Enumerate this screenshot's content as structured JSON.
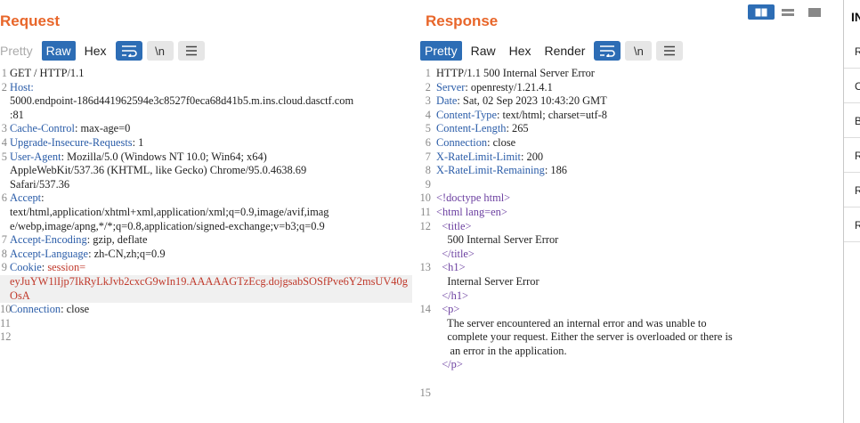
{
  "request": {
    "title": "Request",
    "tabs": [
      "Pretty",
      "Raw",
      "Hex"
    ],
    "active_tab": "Raw",
    "lines": [
      {
        "n": "1",
        "parts": [
          [
            "",
            "GET / HTTP/1.1"
          ]
        ]
      },
      {
        "n": "2",
        "parts": [
          [
            "key",
            "Host:"
          ]
        ]
      },
      {
        "n": "",
        "parts": [
          [
            "",
            "5000.endpoint-186d441962594e3c8527f0eca68d41b5.m.ins.cloud.dasctf.com"
          ]
        ]
      },
      {
        "n": "",
        "parts": [
          [
            "",
            ":81"
          ]
        ]
      },
      {
        "n": "3",
        "parts": [
          [
            "key",
            "Cache-Control"
          ],
          [
            "",
            ": max-age=0"
          ]
        ]
      },
      {
        "n": "4",
        "parts": [
          [
            "key",
            "Upgrade-Insecure-Requests"
          ],
          [
            "",
            ": 1"
          ]
        ]
      },
      {
        "n": "5",
        "parts": [
          [
            "key",
            "User-Agent"
          ],
          [
            "",
            ": Mozilla/5.0 (Windows NT 10.0; Win64; x64)"
          ]
        ]
      },
      {
        "n": "",
        "parts": [
          [
            "",
            "AppleWebKit/537.36 (KHTML, like Gecko) Chrome/95.0.4638.69"
          ]
        ]
      },
      {
        "n": "",
        "parts": [
          [
            "",
            "Safari/537.36"
          ]
        ]
      },
      {
        "n": "6",
        "parts": [
          [
            "key",
            "Accept"
          ],
          [
            "",
            ":"
          ]
        ]
      },
      {
        "n": "",
        "parts": [
          [
            "",
            "text/html,application/xhtml+xml,application/xml;q=0.9,image/avif,imag"
          ]
        ]
      },
      {
        "n": "",
        "parts": [
          [
            "",
            "e/webp,image/apng,*/*;q=0.8,application/signed-exchange;v=b3;q=0.9"
          ]
        ]
      },
      {
        "n": "7",
        "parts": [
          [
            "key",
            "Accept-Encoding"
          ],
          [
            "",
            ": gzip, deflate"
          ]
        ]
      },
      {
        "n": "8",
        "parts": [
          [
            "key",
            "Accept-Language"
          ],
          [
            "",
            ": zh-CN,zh;q=0.9"
          ]
        ]
      },
      {
        "n": "9",
        "parts": [
          [
            "key",
            "Cookie"
          ],
          [
            "",
            ": "
          ],
          [
            "red",
            "session="
          ]
        ]
      },
      {
        "n": "",
        "parts": [
          [
            "red",
            "eyJuYW1lIjp7IkRyLkJvb2cxcG9wIn19.AAAAAGTzEcg.dojgsabSOSfPve6Y2msUV40g"
          ]
        ],
        "hl": true
      },
      {
        "n": "",
        "parts": [
          [
            "red",
            "OsA"
          ]
        ],
        "hl": true
      },
      {
        "n": "10",
        "parts": [
          [
            "key",
            "Connection"
          ],
          [
            "",
            ": close"
          ]
        ]
      },
      {
        "n": "11",
        "parts": [
          [
            "",
            ""
          ]
        ]
      },
      {
        "n": "12",
        "parts": [
          [
            "",
            ""
          ]
        ]
      }
    ]
  },
  "response": {
    "title": "Response",
    "tabs": [
      "Pretty",
      "Raw",
      "Hex",
      "Render"
    ],
    "active_tab": "Pretty",
    "lines": [
      {
        "n": "1",
        "parts": [
          [
            "",
            "HTTP/1.1 500 Internal Server Error"
          ]
        ]
      },
      {
        "n": "2",
        "parts": [
          [
            "key",
            "Server"
          ],
          [
            "",
            ": openresty/1.21.4.1"
          ]
        ]
      },
      {
        "n": "3",
        "parts": [
          [
            "key",
            "Date"
          ],
          [
            "",
            ": Sat, 02 Sep 2023 10:43:20 GMT"
          ]
        ]
      },
      {
        "n": "4",
        "parts": [
          [
            "key",
            "Content-Type"
          ],
          [
            "",
            ": text/html; charset=utf-8"
          ]
        ]
      },
      {
        "n": "5",
        "parts": [
          [
            "key",
            "Content-Length"
          ],
          [
            "",
            ": 265"
          ]
        ]
      },
      {
        "n": "6",
        "parts": [
          [
            "key",
            "Connection"
          ],
          [
            "",
            ": close"
          ]
        ]
      },
      {
        "n": "7",
        "parts": [
          [
            "key",
            "X-RateLimit-Limit"
          ],
          [
            "",
            ": 200"
          ]
        ]
      },
      {
        "n": "8",
        "parts": [
          [
            "key",
            "X-RateLimit-Remaining"
          ],
          [
            "",
            ": 186"
          ]
        ]
      },
      {
        "n": "9",
        "parts": [
          [
            "",
            ""
          ]
        ]
      },
      {
        "n": "10",
        "parts": [
          [
            "tag",
            "<!doctype html>"
          ]
        ]
      },
      {
        "n": "11",
        "parts": [
          [
            "tag",
            "<html lang=en>"
          ]
        ]
      },
      {
        "n": "12",
        "parts": [
          [
            "tag",
            "  <title>"
          ]
        ]
      },
      {
        "n": "",
        "parts": [
          [
            "",
            "    500 Internal Server Error"
          ]
        ]
      },
      {
        "n": "",
        "parts": [
          [
            "tag",
            "  </title>"
          ]
        ]
      },
      {
        "n": "13",
        "parts": [
          [
            "tag",
            "  <h1>"
          ]
        ]
      },
      {
        "n": "",
        "parts": [
          [
            "",
            "    Internal Server Error"
          ]
        ]
      },
      {
        "n": "",
        "parts": [
          [
            "tag",
            "  </h1>"
          ]
        ]
      },
      {
        "n": "14",
        "parts": [
          [
            "tag",
            "  <p>"
          ]
        ]
      },
      {
        "n": "",
        "parts": [
          [
            "",
            "    The server encountered an internal error and was unable to"
          ]
        ]
      },
      {
        "n": "",
        "parts": [
          [
            "",
            "    complete your request. Either the server is overloaded or there is"
          ]
        ]
      },
      {
        "n": "",
        "parts": [
          [
            "",
            "     an error in the application."
          ]
        ]
      },
      {
        "n": "",
        "parts": [
          [
            "tag",
            "  </p>"
          ]
        ]
      },
      {
        "n": "",
        "parts": [
          [
            "",
            ""
          ]
        ]
      },
      {
        "n": "15",
        "parts": [
          [
            "",
            ""
          ]
        ]
      }
    ]
  },
  "inspector": {
    "title": "IN",
    "rows": [
      "R",
      "C",
      "B",
      "R",
      "R",
      "R"
    ]
  },
  "icons": {
    "wrap": "wrap-lines-icon",
    "newline": "\\n",
    "menu": "hamburger-menu-icon"
  },
  "colors": {
    "accent_orange": "#e8662a",
    "active_blue": "#2d6db5",
    "header_key": "#2a5ca8",
    "cookie_red": "#c0392b",
    "html_tag": "#6b3fa0"
  }
}
